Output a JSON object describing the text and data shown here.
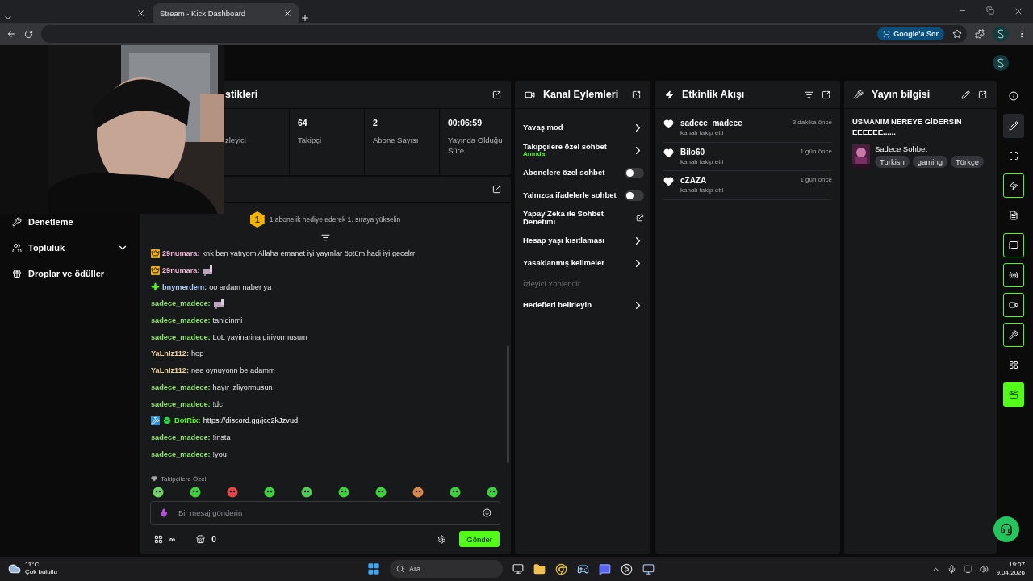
{
  "browser": {
    "tabs": [
      {
        "selected": false
      },
      {
        "title": "Stream - Kick Dashboard",
        "selected": true
      }
    ],
    "ask_button": "Google'a Sor"
  },
  "sidebar": {
    "items": [
      {
        "label": "Denetleme",
        "kind": "link"
      },
      {
        "label": "Topluluk",
        "kind": "group"
      },
      {
        "label": "Droplar ve ödüller",
        "kind": "link"
      }
    ]
  },
  "stats": {
    "title": "stikleri",
    "cells": [
      {
        "label": "zleyici"
      },
      {
        "value": "64",
        "label": "Takipçi"
      },
      {
        "value": "2",
        "label": "Abone Sayısı"
      },
      {
        "value": "00:06:59",
        "label": "Yayında Olduğu Süre"
      }
    ]
  },
  "chat": {
    "banner": {
      "rank": "1",
      "text": "1 abonelik hediye ederek 1. sıraya yükselin"
    },
    "messages": [
      {
        "badges": [
          {
            "kind": "crown"
          }
        ],
        "user": "29numara:",
        "color": "#f2b8d6",
        "kind": "text",
        "text": "knk ben yatıyom Allaha emanet iyi yayınlar öptüm hadi iyi gecelrr"
      },
      {
        "badges": [
          {
            "kind": "crown"
          }
        ],
        "user": "29numara:",
        "color": "#f2b8d6",
        "kind": "emote"
      },
      {
        "badges": [
          {
            "kind": "gem"
          }
        ],
        "user": "bnymerdem:",
        "color": "#a9c8f5",
        "kind": "text",
        "text": "oo ardam naber ya"
      },
      {
        "user": "sadece_madece:",
        "color": "#8fe06f",
        "kind": "emote"
      },
      {
        "user": "sadece_madece:",
        "color": "#8fe06f",
        "kind": "text",
        "text": "tanidinmi"
      },
      {
        "user": "sadece_madece:",
        "color": "#8fe06f",
        "kind": "text",
        "text": "LoL yayinarina giriyormusum"
      },
      {
        "user": "YaLnIz112:",
        "color": "#ecd09a",
        "kind": "text",
        "text": "hop"
      },
      {
        "user": "YaLnIz112:",
        "color": "#ecd09a",
        "kind": "text",
        "text": "nee oynuyonn be adamm"
      },
      {
        "user": "sadece_madece:",
        "color": "#8fe06f",
        "kind": "text",
        "text": "hayır izliyormusun"
      },
      {
        "user": "sadece_madece:",
        "color": "#8fe06f",
        "kind": "text",
        "text": "!dc"
      },
      {
        "badges": [
          {
            "kind": "mod"
          },
          {
            "kind": "verified"
          }
        ],
        "user": "BotRix:",
        "color": "#53fc18",
        "kind": "link",
        "text": "https://discord.gg/jcc2kJzvud"
      },
      {
        "user": "sadece_madece:",
        "color": "#8fe06f",
        "kind": "text",
        "text": "!insta"
      },
      {
        "user": "sadece_madece:",
        "color": "#8fe06f",
        "kind": "text",
        "text": "!you"
      }
    ],
    "emote_section": "Takipçilere Özel",
    "emotes": [
      {
        "color": "#6fd36a"
      },
      {
        "color": "#3fcf3f"
      },
      {
        "color": "#e04848"
      },
      {
        "color": "#3fcf3f"
      },
      {
        "color": "#55c955"
      },
      {
        "color": "#3fcf3f"
      },
      {
        "color": "#3fcf3f"
      },
      {
        "color": "#d9874a"
      },
      {
        "color": "#3fcf3f"
      },
      {
        "color": "#3fcf3f"
      }
    ],
    "input": {
      "placeholder": "Bir mesaj gönderin"
    },
    "points": "∞",
    "store_count": "0",
    "send": "Gönder"
  },
  "channel_actions": {
    "title": "Kanal Eylemleri",
    "items": [
      {
        "label": "Yavaş mod",
        "kind": "arrow"
      },
      {
        "label": "Takipçilere özel sohbet",
        "sub": "Anında",
        "kind": "arrow"
      },
      {
        "label": "Abonelere özel sohbet",
        "kind": "toggle",
        "on": false
      },
      {
        "label": "Yalnızca ifadelerle sohbet",
        "kind": "toggle",
        "on": false
      },
      {
        "label": "Yapay Zeka ile Sohbet Denetimi",
        "kind": "external"
      },
      {
        "label": "Hesap yaşı kısıtlaması",
        "kind": "arrow"
      },
      {
        "label": "Yasaklanmış kelimeler",
        "kind": "arrow"
      },
      {
        "label": "İzleyici Yönlendir",
        "kind": "disabled"
      },
      {
        "label": "Hedefleri belirleyin",
        "kind": "arrow"
      }
    ]
  },
  "activity": {
    "title": "Etkinlik Akışı",
    "events": [
      {
        "user": "sadece_madece",
        "action": "kanalı takip etti",
        "time": "3 dakika önce"
      },
      {
        "user": "Bilo60",
        "action": "kanalı takip etti",
        "time": "1 gün önce"
      },
      {
        "user": "cZAZA",
        "action": "kanalı takip etti",
        "time": "1 gün önce"
      }
    ]
  },
  "stream_info": {
    "title": "Yayın bilgisi",
    "stream_title": "USMANIM NEREYE GİDERSIN EEEEEE......",
    "category": "Sadece Sohbet",
    "tags": [
      "Turkish",
      "gaming",
      "Türkçe"
    ]
  },
  "rail": [
    {
      "kind": "info",
      "selected": false
    },
    {
      "kind": "edit",
      "selected": true
    },
    {
      "kind": "capture",
      "selected": false
    },
    {
      "kind": "bolt",
      "selected": false
    },
    {
      "kind": "doc",
      "selected": false
    },
    {
      "kind": "chat",
      "selected": false
    },
    {
      "kind": "broadcast",
      "selected": false
    },
    {
      "kind": "camera",
      "selected": false
    },
    {
      "kind": "wrench",
      "selected": false
    },
    {
      "kind": "dots",
      "selected": false
    },
    {
      "kind": "clip",
      "selected": false
    }
  ],
  "taskbar": {
    "temperature": "11°C",
    "weather": "Çok bulutlu",
    "search": "Ara",
    "time": "19:07",
    "date": "9.04.2026"
  }
}
